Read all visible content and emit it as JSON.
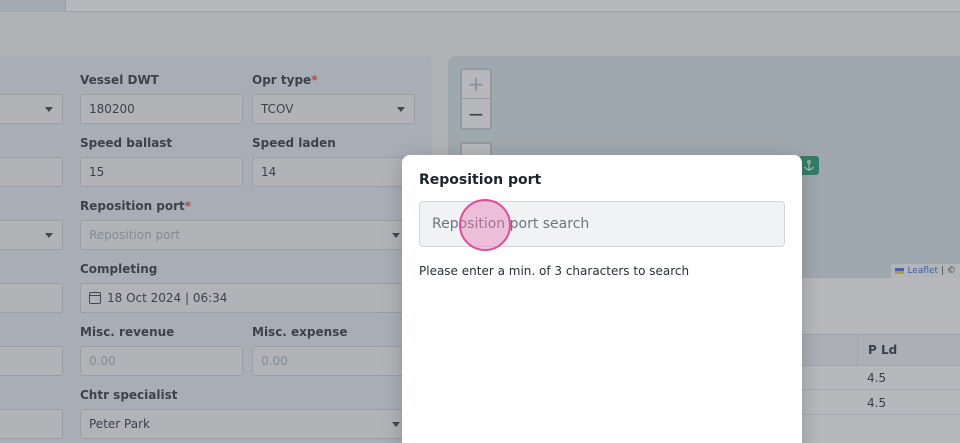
{
  "form": {
    "vessel_dwt": {
      "label": "Vessel DWT",
      "value": "180200"
    },
    "opr_type": {
      "label": "Opr type",
      "required": "*",
      "value": "TCOV"
    },
    "speed_ballast": {
      "label": "Speed ballast",
      "value": "15"
    },
    "speed_laden": {
      "label": "Speed laden",
      "value": "14"
    },
    "reposition_port": {
      "label": "Reposition port",
      "required": "*",
      "placeholder": "Reposition port"
    },
    "completing": {
      "label": "Completing",
      "value": "18 Oct 2024 | 06:34"
    },
    "misc_revenue": {
      "label": "Misc. revenue",
      "placeholder": "0.00"
    },
    "misc_expense": {
      "label": "Misc. expense",
      "placeholder": "0.00"
    },
    "chtr_specialist": {
      "label": "Chtr specialist",
      "value": "Peter Park"
    }
  },
  "map": {
    "zoom_in": "+",
    "zoom_out": "−",
    "attribution_link": "Leaflet",
    "attribution_rest": "| ©"
  },
  "table": {
    "col_pld": "P Ld",
    "rows": [
      {
        "pld": "4.5"
      },
      {
        "pld": "4.5"
      }
    ]
  },
  "modal": {
    "title": "Reposition port",
    "search_placeholder": "Reposition port search",
    "hint": "Please enter a min. of 3 characters to search"
  },
  "colors": {
    "accent_required": "#e5483c",
    "map_marker": "#1e9c6f"
  },
  "icons": {
    "calendar": "calendar-icon",
    "anchor": "anchor-icon",
    "caret": "chevron-down-icon"
  }
}
